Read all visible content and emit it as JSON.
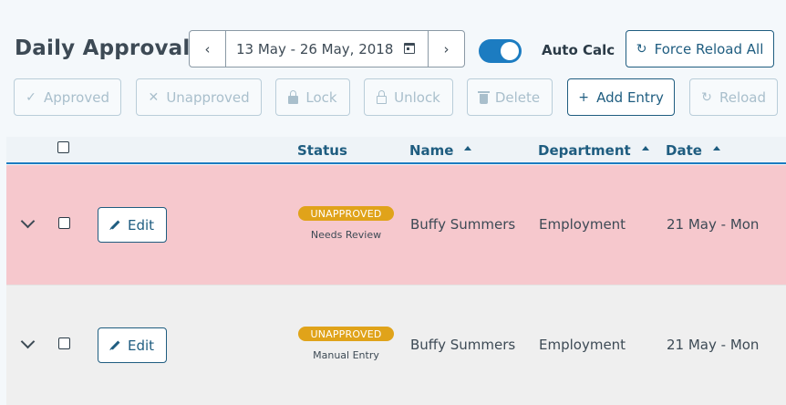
{
  "page": {
    "title": "Daily Approval"
  },
  "date_range": {
    "text": "13 May - 26 May, 2018",
    "prev_label": "‹",
    "next_label": "›"
  },
  "auto_calc": {
    "label": "Auto Calc",
    "enabled": true
  },
  "toolbar": {
    "force_reload_label": "Force Reload All",
    "approved_label": "Approved",
    "unapproved_label": "Unapproved",
    "lock_label": "Lock",
    "unlock_label": "Unlock",
    "delete_label": "Delete",
    "add_entry_label": "Add Entry",
    "reload_label": "Reload"
  },
  "table": {
    "columns": {
      "status": "Status",
      "name": "Name",
      "department": "Department",
      "date": "Date"
    },
    "edit_label": "Edit",
    "rows": [
      {
        "status": "UNAPPROVED",
        "status_note": "Needs Review",
        "name": "Buffy Summers",
        "department": "Employment",
        "date": "21 May - Mon"
      },
      {
        "status": "UNAPPROVED",
        "status_note": "Manual Entry",
        "name": "Buffy Summers",
        "department": "Employment",
        "date": "21 May - Mon"
      }
    ]
  },
  "colors": {
    "accent": "#1c7cc1",
    "primary_text": "#1f5d80",
    "badge_unapproved": "#e0a31a",
    "row_flagged": "#f6c8cd",
    "row_default": "#efefef"
  }
}
